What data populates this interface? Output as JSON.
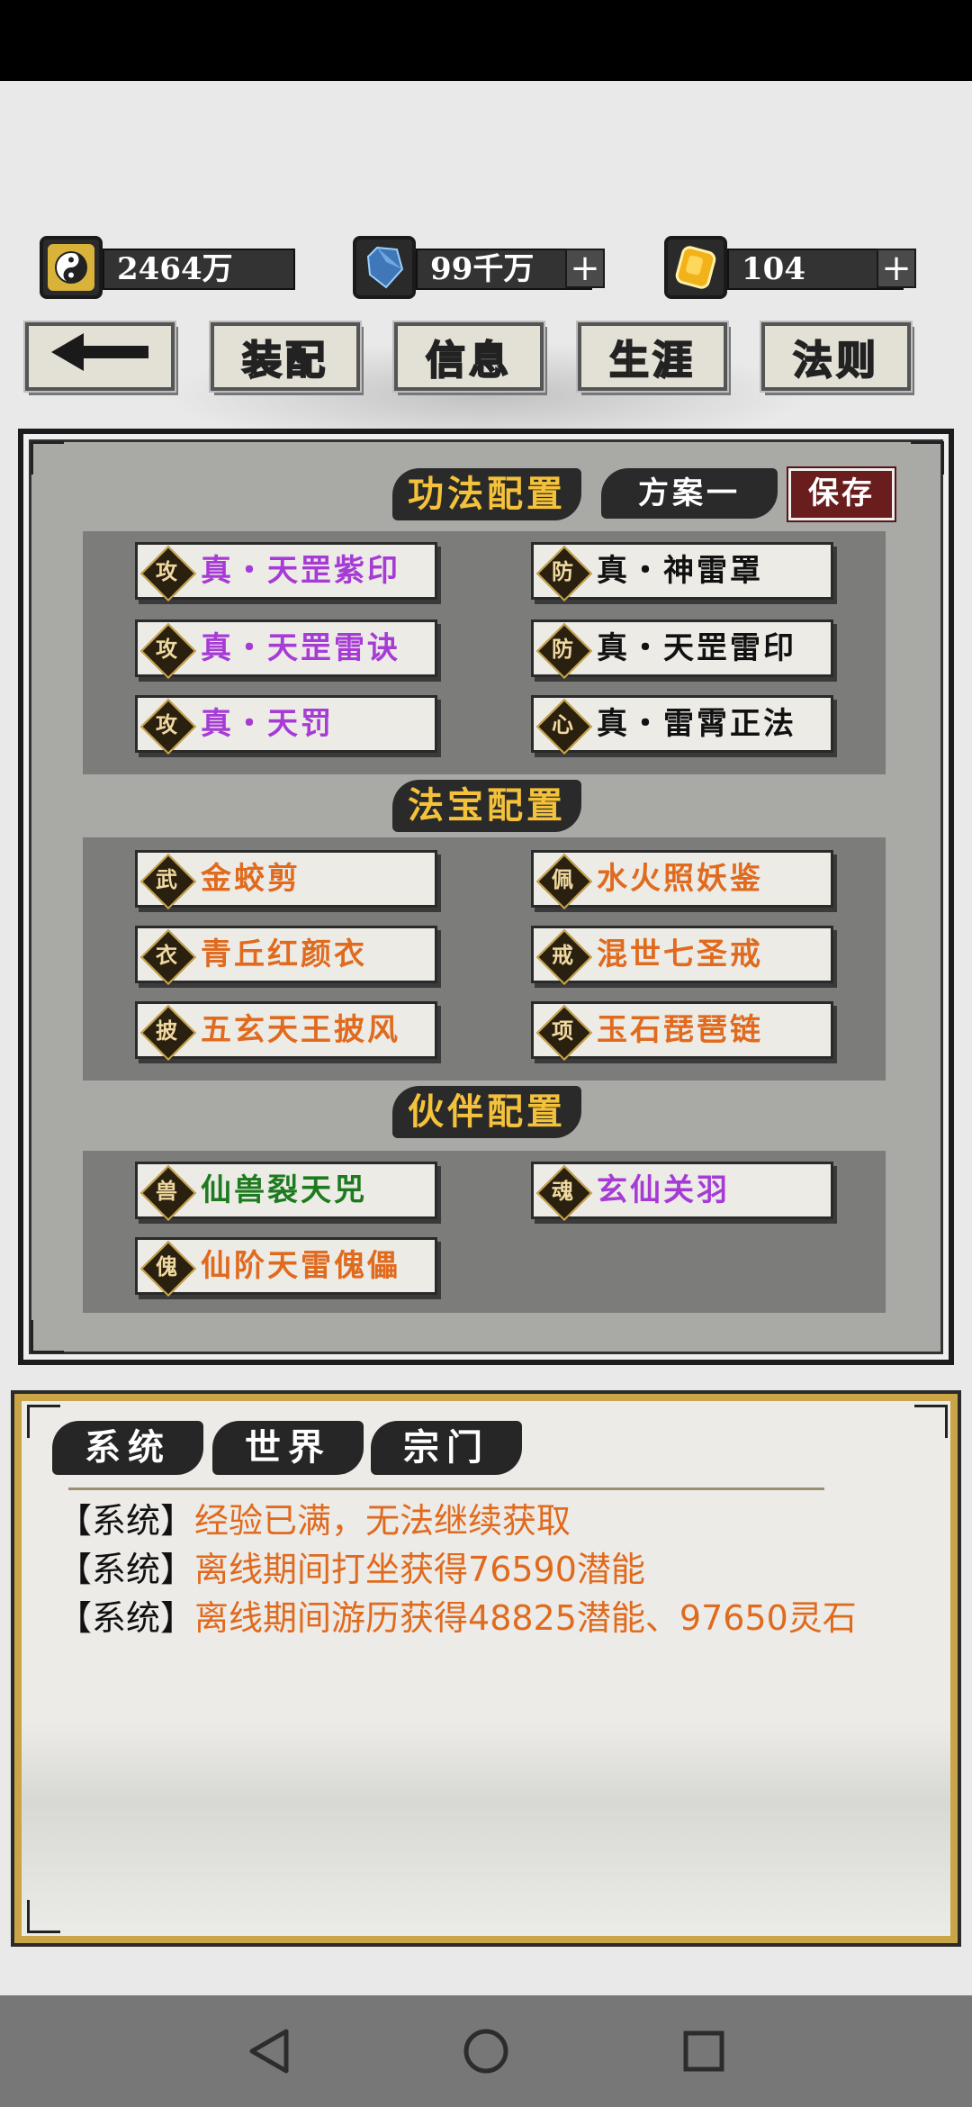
{
  "currency": [
    {
      "icon": "yinyang-icon",
      "value": "2464万",
      "has_plus": false
    },
    {
      "icon": "crystal-icon",
      "value": "99千万",
      "has_plus": true
    },
    {
      "icon": "gold-gem-icon",
      "value": "104",
      "has_plus": true
    }
  ],
  "nav": {
    "back_icon": "back-arrow-icon",
    "tabs": [
      "装配",
      "信息",
      "生涯",
      "法则"
    ],
    "active": "装配"
  },
  "skills": {
    "title": "功法配置",
    "plan": "方案一",
    "save": "保存",
    "items": [
      {
        "tag": "攻",
        "name": "真・天罡紫印",
        "color": "#a63bd6"
      },
      {
        "tag": "防",
        "name": "真・神雷罩",
        "color": "#111111"
      },
      {
        "tag": "攻",
        "name": "真・天罡雷诀",
        "color": "#a63bd6"
      },
      {
        "tag": "防",
        "name": "真・天罡雷印",
        "color": "#111111"
      },
      {
        "tag": "攻",
        "name": "真・天罚",
        "color": "#a63bd6"
      },
      {
        "tag": "心",
        "name": "真・雷霄正法",
        "color": "#111111"
      }
    ]
  },
  "treasures": {
    "title": "法宝配置",
    "items": [
      {
        "tag": "武",
        "name": "金蛟剪",
        "color": "#e06a1e"
      },
      {
        "tag": "佩",
        "name": "水火照妖鉴",
        "color": "#e06a1e"
      },
      {
        "tag": "衣",
        "name": "青丘红颜衣",
        "color": "#e06a1e"
      },
      {
        "tag": "戒",
        "name": "混世七圣戒",
        "color": "#e06a1e"
      },
      {
        "tag": "披",
        "name": "五玄天王披风",
        "color": "#e06a1e"
      },
      {
        "tag": "项",
        "name": "玉石琵琶链",
        "color": "#e06a1e"
      }
    ]
  },
  "partners": {
    "title": "伙伴配置",
    "items": [
      {
        "tag": "兽",
        "name": "仙兽裂天兕",
        "color": "#1e7a1e"
      },
      {
        "tag": "魂",
        "name": "玄仙关羽",
        "color": "#a63bd6"
      },
      {
        "tag": "傀",
        "name": "仙阶天雷傀儡",
        "color": "#e06a1e"
      }
    ]
  },
  "chat": {
    "tabs": [
      "系统",
      "世界",
      "宗门"
    ],
    "active": "系统",
    "messages": [
      {
        "channel": "【系统】",
        "text": "经验已满，无法继续获取"
      },
      {
        "channel": "【系统】",
        "text": "离线期间打坐获得76590潜能"
      },
      {
        "channel": "【系统】",
        "text": "离线期间游历获得48825潜能、97650灵石"
      }
    ]
  },
  "system_nav": [
    "back-triangle-icon",
    "home-circle-icon",
    "recents-square-icon"
  ]
}
